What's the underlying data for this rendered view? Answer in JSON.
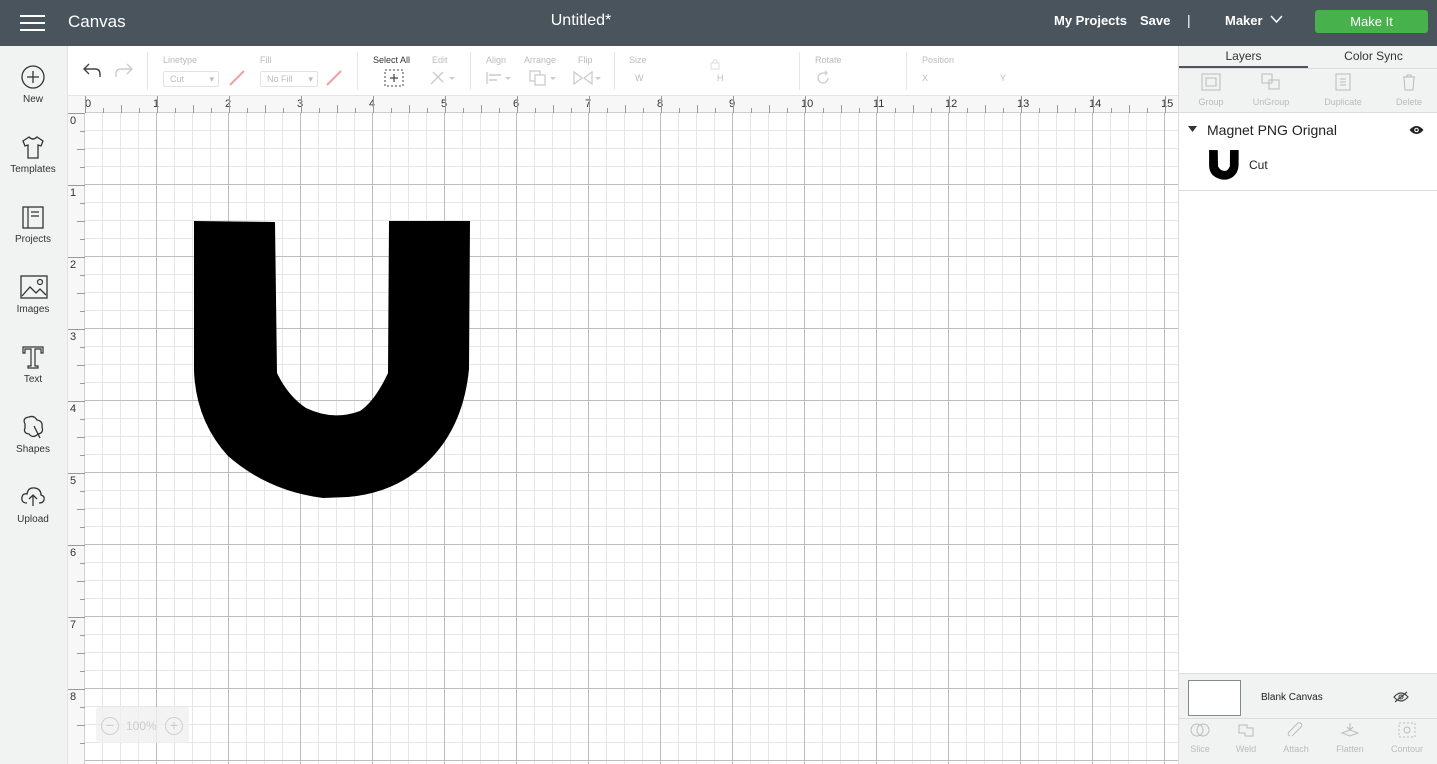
{
  "header": {
    "app_title": "Canvas",
    "doc_title": "Untitled*",
    "my_projects": "My Projects",
    "save": "Save",
    "separator": "|",
    "machine": "Maker",
    "make_it": "Make It"
  },
  "sidebar": {
    "items": [
      {
        "label": "New",
        "icon": "plus-circle-icon"
      },
      {
        "label": "Templates",
        "icon": "tshirt-icon"
      },
      {
        "label": "Projects",
        "icon": "book-icon"
      },
      {
        "label": "Images",
        "icon": "image-icon"
      },
      {
        "label": "Text",
        "icon": "text-icon"
      },
      {
        "label": "Shapes",
        "icon": "shapes-icon"
      },
      {
        "label": "Upload",
        "icon": "cloud-upload-icon"
      }
    ]
  },
  "toolbar": {
    "linetype_label": "Linetype",
    "linetype_value": "Cut",
    "fill_label": "Fill",
    "fill_value": "No Fill",
    "select_all": "Select All",
    "edit": "Edit",
    "align": "Align",
    "arrange": "Arrange",
    "flip": "Flip",
    "size": "Size",
    "w": "W",
    "h": "H",
    "rotate": "Rotate",
    "position": "Position",
    "x": "X",
    "y": "Y"
  },
  "canvas": {
    "ruler_top": [
      "0",
      "1",
      "2",
      "3",
      "4",
      "5",
      "6",
      "7",
      "8",
      "9",
      "10",
      "11",
      "12",
      "13",
      "14",
      "15"
    ],
    "ruler_left": [
      "0",
      "1",
      "2",
      "3",
      "4",
      "5",
      "6",
      "7",
      "8"
    ],
    "zoom": "100%"
  },
  "right_panel": {
    "tabs": [
      "Layers",
      "Color Sync"
    ],
    "tools": [
      "Group",
      "UnGroup",
      "Duplicate",
      "Delete"
    ],
    "group_name": "Magnet PNG Orignal",
    "layer_name": "Cut",
    "blank_canvas": "Blank Canvas",
    "bottom_tools": [
      "Slice",
      "Weld",
      "Attach",
      "Flatten",
      "Contour"
    ]
  },
  "colors": {
    "header_bg": "#4a545c",
    "make_it_green": "#47b14c",
    "panel_bg": "#f1f2f2"
  }
}
